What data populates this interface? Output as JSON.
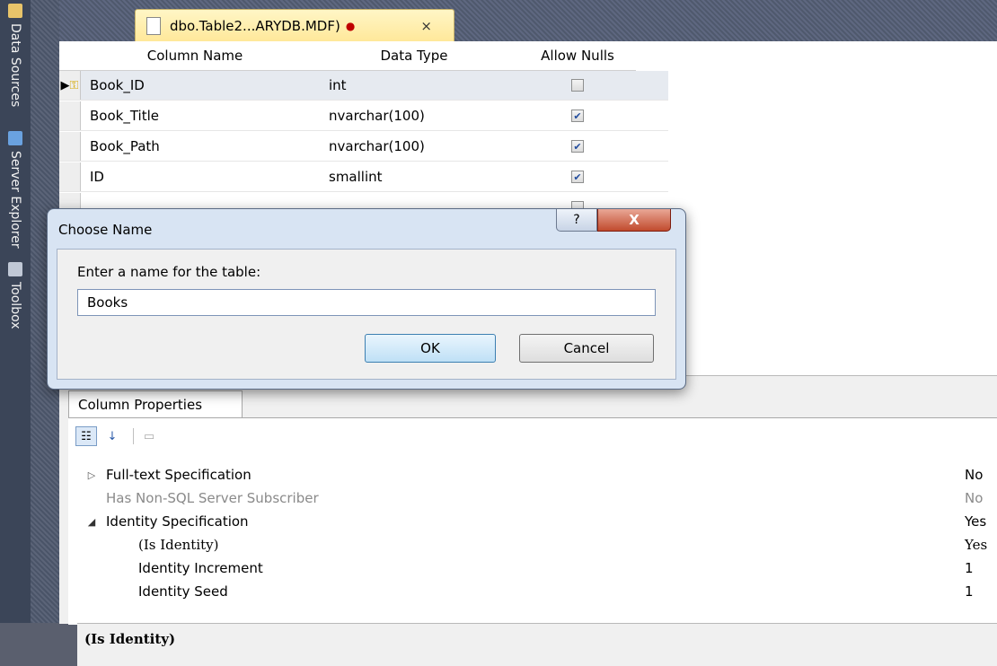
{
  "dock": {
    "tabs": [
      {
        "label": "Data Sources",
        "icon": "database-icon"
      },
      {
        "label": "Server Explorer",
        "icon": "server-icon"
      },
      {
        "label": "Toolbox",
        "icon": "toolbox-icon"
      }
    ]
  },
  "document_tab": {
    "title": "dbo.Table2...ARYDB.MDF)",
    "modified_marker": "●",
    "close_glyph": "×"
  },
  "grid": {
    "headers": {
      "name": "Column Name",
      "type": "Data Type",
      "nulls": "Allow Nulls"
    },
    "rows": [
      {
        "name": "Book_ID",
        "type": "int",
        "allow_nulls": false,
        "primary_key": true
      },
      {
        "name": "Book_Title",
        "type": "nvarchar(100)",
        "allow_nulls": true
      },
      {
        "name": "Book_Path",
        "type": "nvarchar(100)",
        "allow_nulls": true
      },
      {
        "name": "ID",
        "type": "smallint",
        "allow_nulls": true
      },
      {
        "name": "",
        "type": "",
        "allow_nulls": false
      }
    ]
  },
  "dialog": {
    "title": "Choose Name",
    "help_glyph": "?",
    "close_glyph": "X",
    "prompt": "Enter a name for the table:",
    "value": "Books",
    "ok_label": "OK",
    "cancel_label": "Cancel"
  },
  "properties": {
    "tab_label": "Column Properties",
    "rows": [
      {
        "expander": "▷",
        "name": "Full-text Specification",
        "value": "No",
        "dim": false,
        "indent": false
      },
      {
        "expander": "",
        "name": "Has Non-SQL Server Subscriber",
        "value": "No",
        "dim": true,
        "indent": false
      },
      {
        "expander": "◢",
        "name": "Identity Specification",
        "value": "Yes",
        "dim": false,
        "indent": false
      },
      {
        "expander": "",
        "name": "(Is Identity)",
        "value": "Yes",
        "dim": false,
        "indent": true
      },
      {
        "expander": "",
        "name": "Identity Increment",
        "value": "1",
        "dim": false,
        "indent": true
      },
      {
        "expander": "",
        "name": "Identity Seed",
        "value": "1",
        "dim": false,
        "indent": true
      }
    ],
    "description": "(Is Identity)"
  }
}
